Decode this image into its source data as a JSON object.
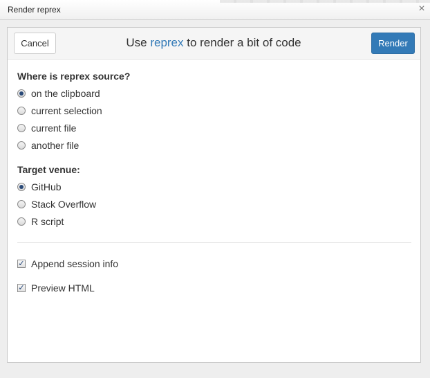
{
  "window": {
    "title": "Render reprex",
    "close_glyph": "×"
  },
  "header": {
    "cancel_label": "Cancel",
    "render_label": "Render",
    "title_prefix": "Use ",
    "title_accent": "reprex",
    "title_suffix": " to render a bit of code",
    "accent_color": "#337ab7"
  },
  "source": {
    "label": "Where is reprex source?",
    "options": [
      {
        "label": "on the clipboard",
        "checked": true
      },
      {
        "label": "current selection",
        "checked": false
      },
      {
        "label": "current file",
        "checked": false
      },
      {
        "label": "another file",
        "checked": false
      }
    ]
  },
  "venue": {
    "label": "Target venue:",
    "options": [
      {
        "label": "GitHub",
        "checked": true
      },
      {
        "label": "Stack Overflow",
        "checked": false
      },
      {
        "label": "R script",
        "checked": false
      }
    ]
  },
  "checks": [
    {
      "label": "Append session info",
      "checked": true,
      "glyph": "✓"
    },
    {
      "label": "Preview HTML",
      "checked": true,
      "glyph": "✓"
    }
  ]
}
